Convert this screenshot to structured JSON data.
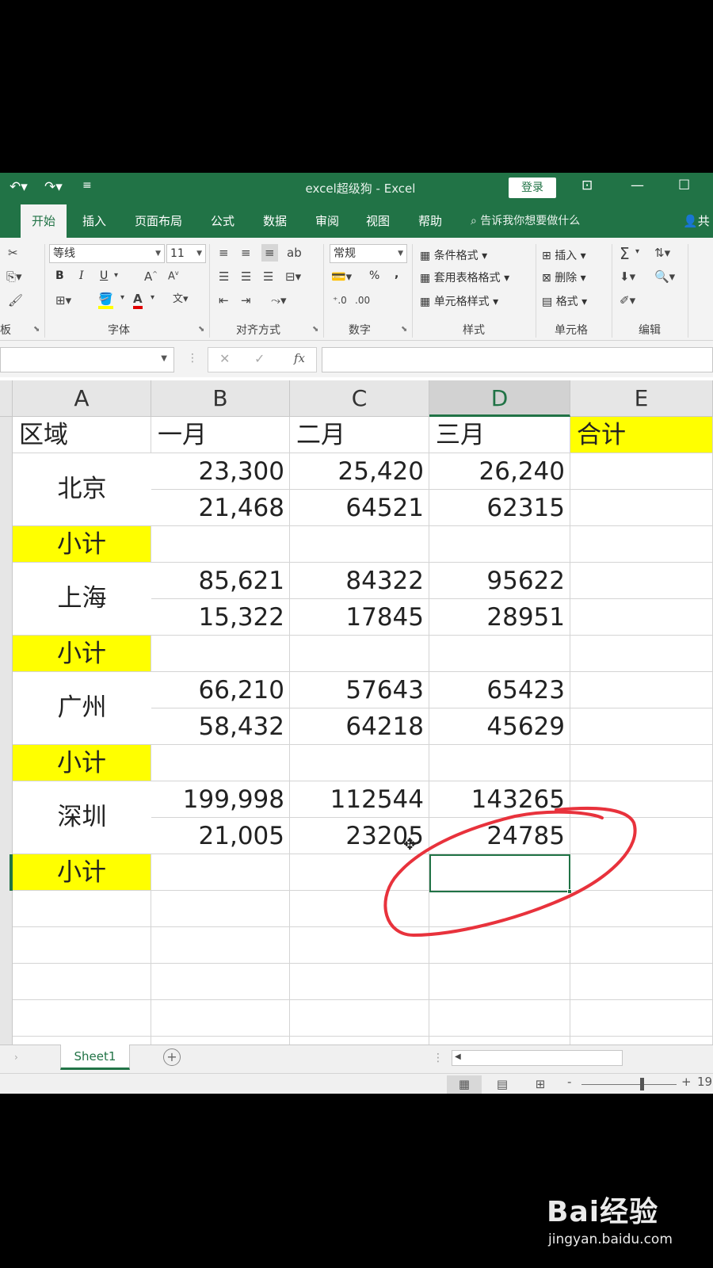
{
  "window": {
    "title": "excel超级狗 - Excel",
    "login_label": "登录"
  },
  "tabs": [
    "开始",
    "插入",
    "页面布局",
    "公式",
    "数据",
    "审阅",
    "视图",
    "帮助"
  ],
  "tell_me": "告诉我你想要做什么",
  "share_label": "共",
  "ribbon": {
    "clipboard_group": "板",
    "font_name": "等线",
    "font_size": "11",
    "font_group": "字体",
    "align_group": "对齐方式",
    "number_format": "常规",
    "number_group": "数字",
    "conditional_format": "条件格式",
    "table_format": "套用表格格式",
    "cell_style": "单元格样式",
    "styles_group": "样式",
    "insert_label": "插入",
    "delete_label": "删除",
    "format_label": "格式",
    "cells_group": "单元格",
    "editing_group": "编辑",
    "bold": "B",
    "italic": "I",
    "underline": "U",
    "percent": "%",
    "comma": ","
  },
  "formula_bar": {
    "cancel": "✕",
    "enter": "✓",
    "fx": "fx"
  },
  "columns": [
    "A",
    "B",
    "C",
    "D",
    "E"
  ],
  "header_row": [
    "区域",
    "一月",
    "二月",
    "三月",
    "合计"
  ],
  "regions": [
    "北京",
    "上海",
    "广州",
    "深圳"
  ],
  "subtotal_label": "小计",
  "values": [
    [
      "23,300",
      "25,420",
      "26,240"
    ],
    [
      "21,468",
      "64521",
      "62315"
    ],
    [
      "85,621",
      "84322",
      "95622"
    ],
    [
      "15,322",
      "17845",
      "28951"
    ],
    [
      "66,210",
      "57643",
      "65423"
    ],
    [
      "58,432",
      "64218",
      "45629"
    ],
    [
      "199,998",
      "112544",
      "143265"
    ],
    [
      "21,005",
      "23205",
      "24785"
    ]
  ],
  "sheet_tab": "Sheet1",
  "zoom_text": "19",
  "colors": {
    "excel_green": "#217346",
    "highlight_yellow": "#ffff00",
    "annotation_red": "#e8323c"
  },
  "watermark": {
    "brand": "Bai经验",
    "url": "jingyan.baidu.com"
  }
}
